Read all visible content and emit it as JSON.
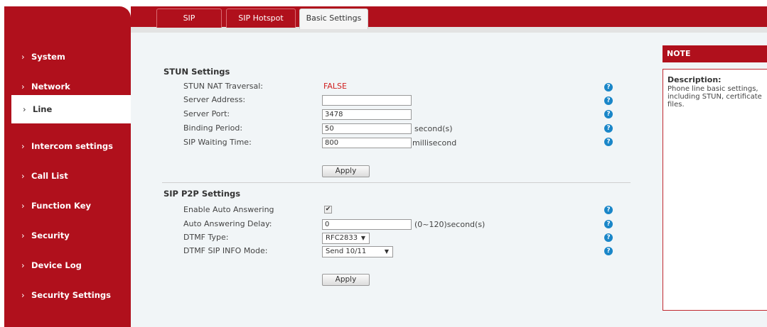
{
  "tabs": [
    {
      "label": "SIP"
    },
    {
      "label": "SIP Hotspot"
    },
    {
      "label": "Basic Settings"
    }
  ],
  "sidebar": {
    "items": [
      {
        "label": "System"
      },
      {
        "label": "Network"
      },
      {
        "label": "Line"
      },
      {
        "label": "Intercom settings"
      },
      {
        "label": "Call List"
      },
      {
        "label": "Function Key"
      },
      {
        "label": "Security"
      },
      {
        "label": "Device Log"
      },
      {
        "label": "Security Settings"
      }
    ],
    "active": "Line",
    "chevron": "›"
  },
  "stun": {
    "title": "STUN Settings",
    "nat_label": "STUN NAT Traversal:",
    "nat_value": "FALSE",
    "server_address_label": "Server Address:",
    "server_address_value": "",
    "server_port_label": "Server Port:",
    "server_port_value": "3478",
    "binding_label": "Binding Period:",
    "binding_value": "50",
    "binding_unit": "second(s)",
    "waiting_label": "SIP Waiting Time:",
    "waiting_value": "800",
    "waiting_unit": "millisecond",
    "apply_label": "Apply"
  },
  "p2p": {
    "title": "SIP P2P Settings",
    "auto_answer_label": "Enable Auto Answering",
    "auto_answer_checked": true,
    "auto_answer_mark": "✔",
    "delay_label": "Auto Answering Delay:",
    "delay_value": "0",
    "delay_unit": "(0~120)second(s)",
    "dtmf_type_label": "DTMF Type:",
    "dtmf_type_value": "RFC2833",
    "dtmf_info_label": "DTMF SIP INFO Mode:",
    "dtmf_info_value": "Send 10/11",
    "apply_label": "Apply"
  },
  "help_glyph": "?",
  "note": {
    "heading": "NOTE",
    "title": "Description:",
    "text": "Phone line basic settings, including STUN, certificate files."
  },
  "colors": {
    "brand_red": "#b0101c",
    "help_blue": "#1a86c8",
    "false_red": "#d02020"
  }
}
